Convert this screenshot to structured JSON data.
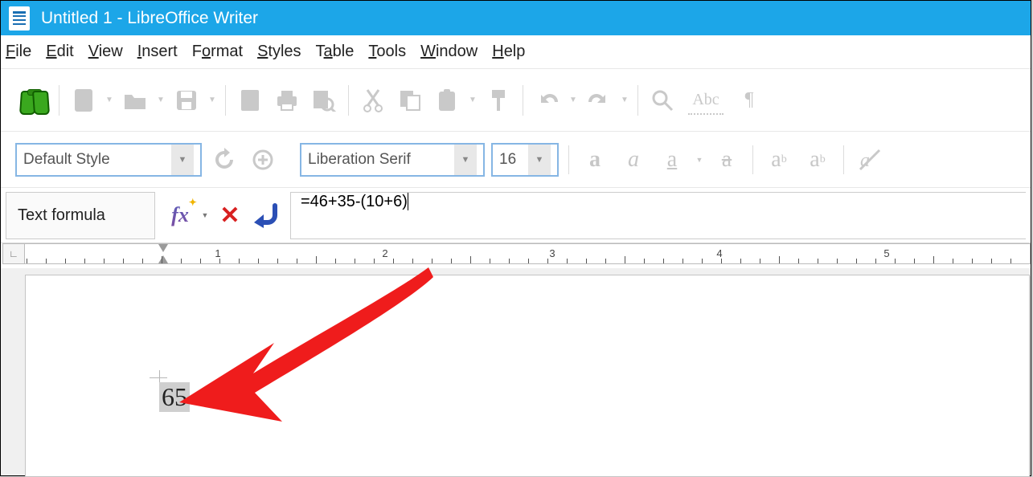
{
  "window": {
    "title": "Untitled 1 - LibreOffice Writer"
  },
  "menu": {
    "file": "File",
    "edit": "Edit",
    "view": "View",
    "insert": "Insert",
    "format": "Format",
    "styles": "Styles",
    "table": "Table",
    "tools": "Tools",
    "window": "Window",
    "help": "Help"
  },
  "formatting": {
    "paragraph_style": "Default Style",
    "font_name": "Liberation Serif",
    "font_size": "16"
  },
  "formula_bar": {
    "label": "Text formula",
    "input": "=46+35-(10+6)"
  },
  "document": {
    "result": "65"
  },
  "ruler": {
    "marks": [
      "1",
      "2",
      "3",
      "4",
      "5"
    ]
  }
}
